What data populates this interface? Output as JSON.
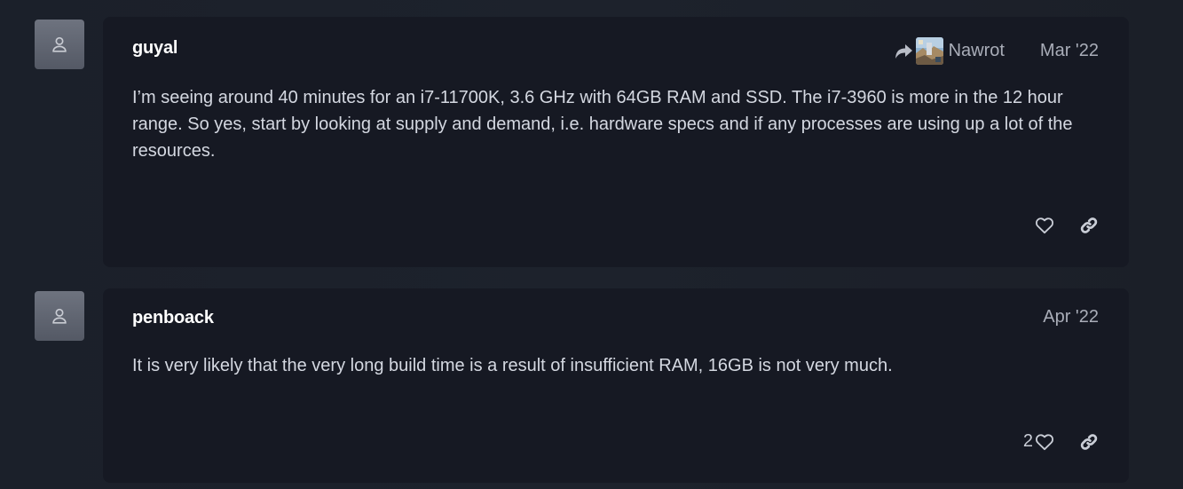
{
  "posts": [
    {
      "author": "guyal",
      "reply_to": "Nawrot",
      "date": "Mar '22",
      "body": "I’m seeing around 40 minutes for an i7-11700K, 3.6 GHz with 64GB RAM and SSD. The i7-3960 is more in the 12 hour range. So yes, start by looking at supply and demand, i.e. hardware specs and if any processes are using up a lot of the resources.",
      "likes": ""
    },
    {
      "author": "penboack",
      "reply_to": "",
      "date": "Apr '22",
      "body": "It is very likely that the very long build time is a result of insufficient RAM, 16GB is not very much.",
      "likes": "2"
    }
  ],
  "icons": {
    "avatar": "user-icon",
    "reply": "share-arrow-icon",
    "like": "heart-icon",
    "link": "link-icon"
  },
  "colors": {
    "page_background": "#1c212b",
    "card_background": "#161923",
    "avatar_background": "#61666f",
    "username": "#ffffff",
    "meta_text": "#a9adb8",
    "body_text": "#d4d8e1"
  }
}
